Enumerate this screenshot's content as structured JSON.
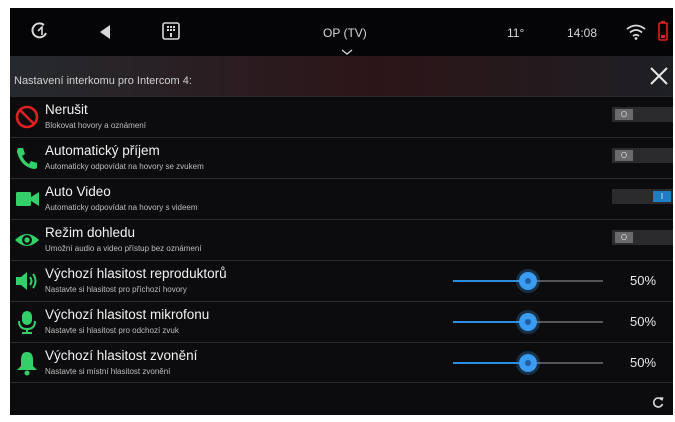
{
  "statusbar": {
    "source": "OP (TV)",
    "temperature": "11°",
    "time": "14:08"
  },
  "header": {
    "title": "Nastavení interkomu pro Intercom 4:"
  },
  "rows": [
    {
      "label": "Nerušit",
      "sub": "Blokovat hovory a oznámení",
      "icon": "do-not-disturb-icon",
      "type": "toggle",
      "state": "O",
      "on": false
    },
    {
      "label": "Automatický příjem",
      "sub": "Automaticky odpovídat na hovory se zvukem",
      "icon": "phone-icon",
      "type": "toggle",
      "state": "O",
      "on": false
    },
    {
      "label": "Auto Video",
      "sub": "Automaticky odpovídat na hovory s videem",
      "icon": "video-camera-icon",
      "type": "toggle",
      "state": "I",
      "on": true
    },
    {
      "label": "Režim dohledu",
      "sub": "Umožní audio a video přístup bez oznámení",
      "icon": "eye-icon",
      "type": "toggle",
      "state": "O",
      "on": false
    },
    {
      "label": "Výchozí hlasitost reproduktorů",
      "sub": "Nastavte si hlasitost pro příchozí hovory",
      "icon": "speaker-icon",
      "type": "slider",
      "value": "50%",
      "level": 0.5
    },
    {
      "label": "Výchozí hlasitost mikrofonu",
      "sub": "Nastavte si hlasitost pro odchozí zvuk",
      "icon": "microphone-icon",
      "type": "slider",
      "value": "50%",
      "level": 0.5
    },
    {
      "label": "Výchozí hlasitost zvonění",
      "sub": "Nastavte si místní hlasitost zvonění",
      "icon": "bell-icon",
      "type": "slider",
      "value": "50%",
      "level": 0.5
    }
  ],
  "colors": {
    "accent_green": "#33d06a",
    "accent_red": "#e02020",
    "accent_blue": "#2d8ee0"
  }
}
